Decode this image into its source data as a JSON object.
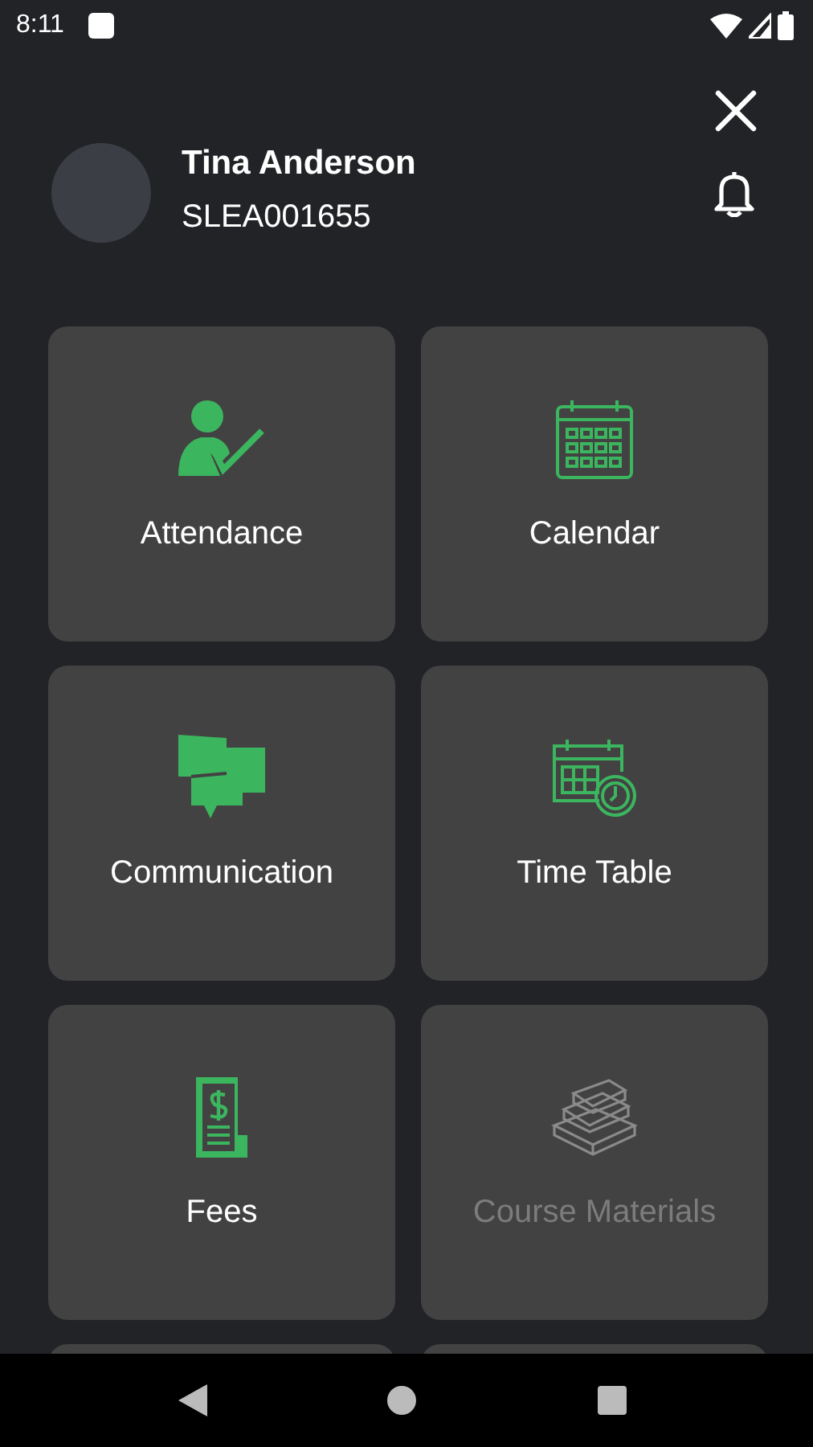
{
  "status_bar": {
    "time": "8:11"
  },
  "profile": {
    "name": "Tina Anderson",
    "id": "SLEA001655"
  },
  "tiles": [
    {
      "label": "Attendance",
      "kind": "attendance",
      "disabled": false
    },
    {
      "label": "Calendar",
      "kind": "calendar",
      "disabled": false
    },
    {
      "label": "Communication",
      "kind": "communication",
      "disabled": false
    },
    {
      "label": "Time Table",
      "kind": "timetable",
      "disabled": false
    },
    {
      "label": "Fees",
      "kind": "fees",
      "disabled": false
    },
    {
      "label": "Course Materials",
      "kind": "materials",
      "disabled": true
    }
  ]
}
